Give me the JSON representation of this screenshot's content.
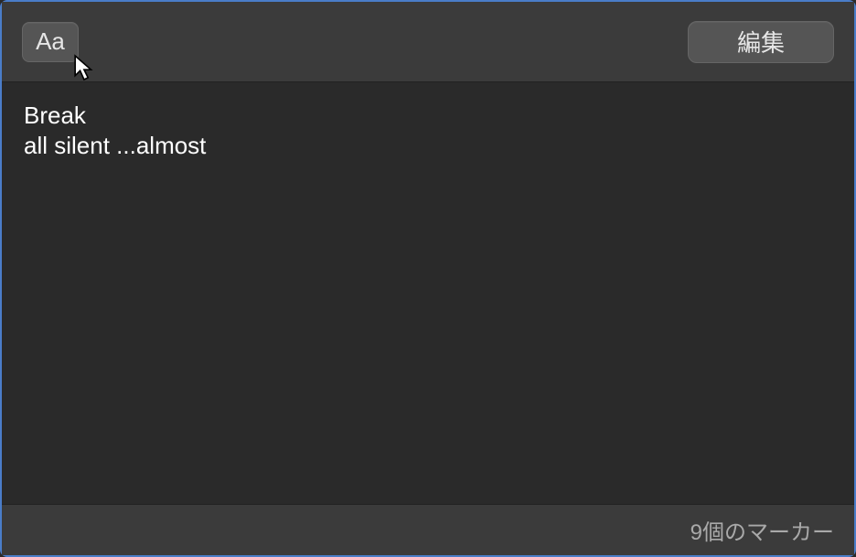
{
  "toolbar": {
    "font_button_label": "Aa",
    "edit_button_label": "編集"
  },
  "content": {
    "line1": "Break",
    "line2": "all silent ...almost"
  },
  "status": {
    "marker_count_text": "9個のマーカー"
  }
}
